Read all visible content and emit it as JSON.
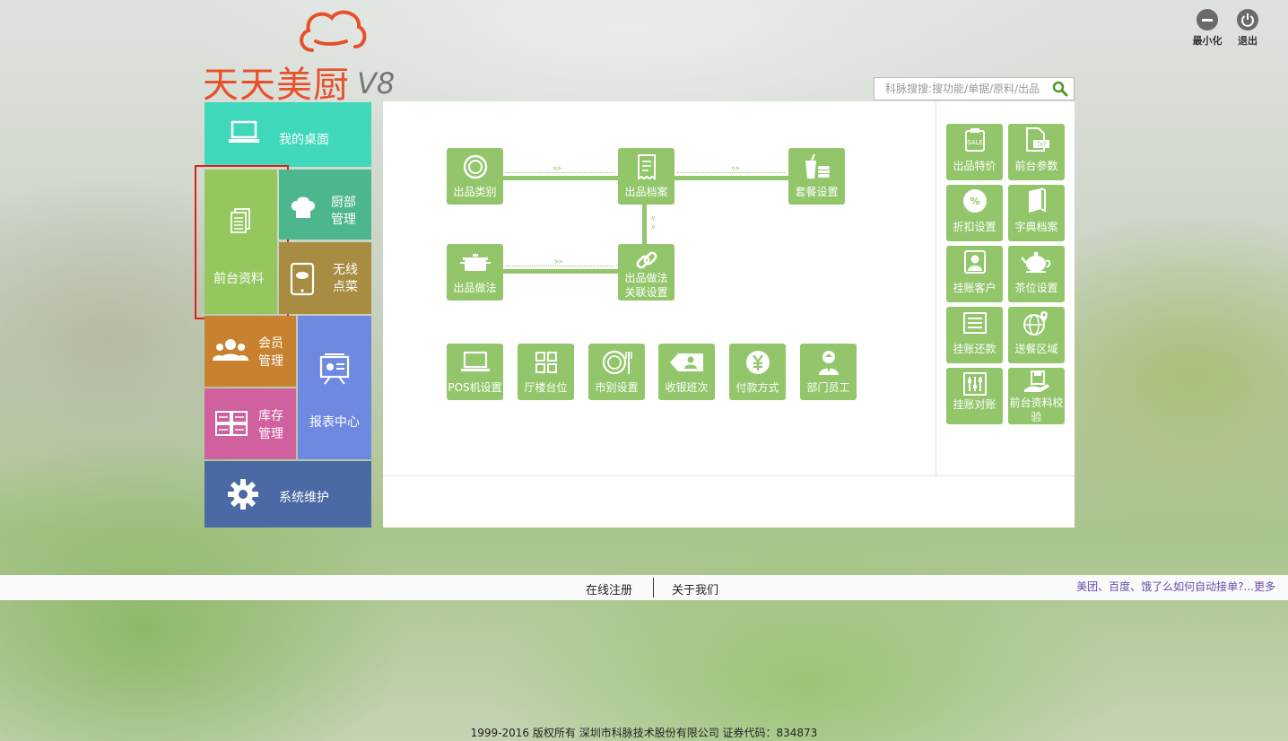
{
  "window": {
    "minimize_label": "最小化",
    "exit_label": "退出"
  },
  "logo": {
    "name": "天天美厨",
    "version": "V8",
    "brand_color": "#e8502a"
  },
  "search": {
    "placeholder": "科脉搜搜:搜功能/单据/原料/出品"
  },
  "nav": {
    "desktop": "我的桌面",
    "frontdesk": "前台资料",
    "kitchen": "厨部管理",
    "wireless": "无线点菜",
    "member": "会员管理",
    "report": "报表中心",
    "inventory": "库存管理",
    "system": "系统维护",
    "highlight_color": "#e0201a"
  },
  "flow": {
    "category": "出品类别",
    "archive": "出品档案",
    "combo": "套餐设置",
    "method": "出品做法",
    "method_link": "出品做法关联设置",
    "arrows": ">>",
    "varrows": "v v"
  },
  "bottom_tiles": {
    "pos": "POS机设置",
    "hall": "厅楼台位",
    "market": "市别设置",
    "shift": "收银班次",
    "payment": "付款方式",
    "staff": "部门员工"
  },
  "side_tiles": {
    "special_price": "出品特价",
    "frontdesk_params": "前台参数",
    "discount": "折扣设置",
    "dictionary": "字典档案",
    "credit_customer": "挂账客户",
    "tea_setting": "茶位设置",
    "credit_repay": "挂账还款",
    "delivery_area": "送餐区域",
    "credit_reconcile": "挂账对账",
    "frontdesk_check": "前台资料校验"
  },
  "footer": {
    "register": "在线注册",
    "about": "关于我们",
    "news": "美团、百度、饿了么如何自动接单?...更多",
    "copyright": "1999-2016  版权所有  深圳市科脉技术股份有限公司  证券代码：834873"
  },
  "colors": {
    "tile_green": "#93c66b",
    "desktop_tile": "#3fd8bb",
    "frontdesk_tile": "#95c75f",
    "kitchen_tile": "#4cb68c",
    "wireless_tile": "#a88c42",
    "member_tile": "#c8822f",
    "report_tile": "#6f89e0",
    "inventory_tile": "#d0609e",
    "system_tile": "#4a69a5"
  }
}
